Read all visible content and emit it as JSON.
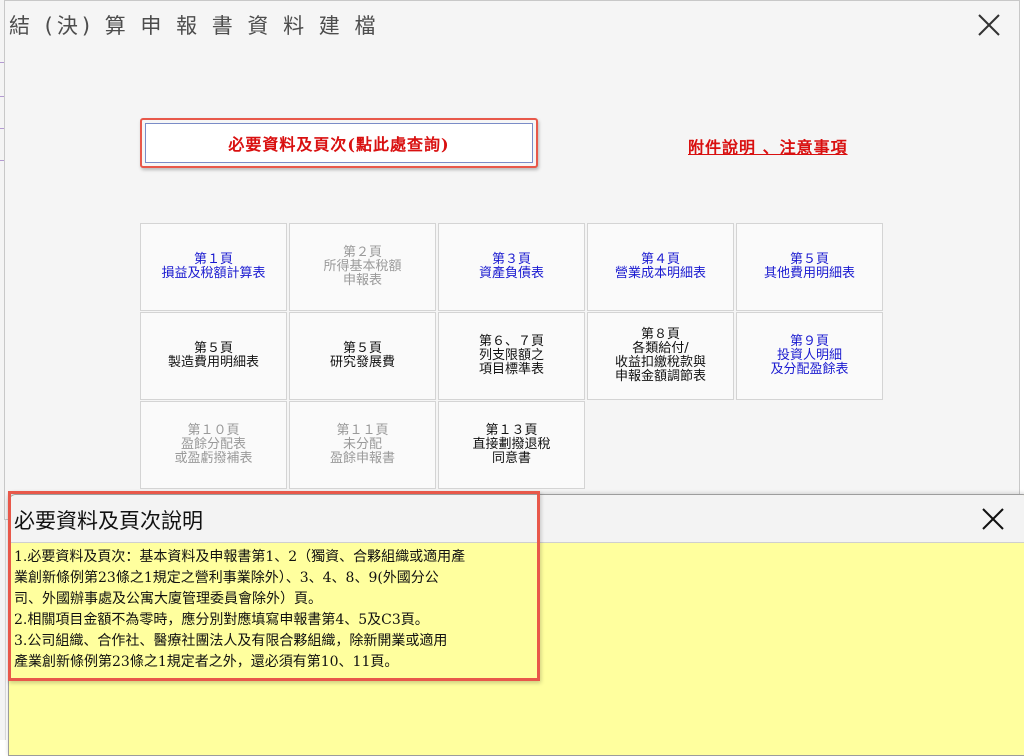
{
  "window": {
    "title": "結 (決) 算 申 報 書 資 料 建 檔"
  },
  "main": {
    "required_button_label": "必要資料及頁次(點此處查詢)",
    "notes_link_label": "附件說明 、注意事項",
    "pages": [
      {
        "label": "第１頁\n損益及稅額計算表",
        "state": "blue"
      },
      {
        "label": "第２頁\n所得基本稅額\n申報表",
        "state": "gray"
      },
      {
        "label": "第３頁\n資產負債表",
        "state": "blue"
      },
      {
        "label": "第４頁\n營業成本明細表",
        "state": "blue"
      },
      {
        "label": "第５頁\n其他費用明細表",
        "state": "blue"
      },
      {
        "label": "第５頁\n製造費用明細表",
        "state": "black"
      },
      {
        "label": "第５頁\n研究發展費",
        "state": "black"
      },
      {
        "label": "第６、７頁\n列支限額之\n項目標準表",
        "state": "black"
      },
      {
        "label": "第８頁\n各類給付/\n收益扣繳稅款與\n申報金額調節表",
        "state": "black"
      },
      {
        "label": "第９頁\n投資人明細\n及分配盈餘表",
        "state": "blue"
      },
      {
        "label": "第１０頁\n盈餘分配表\n或盈虧撥補表",
        "state": "gray"
      },
      {
        "label": "第１１頁\n未分配\n盈餘申報書",
        "state": "gray"
      },
      {
        "label": "第１３頁\n直接劃撥退稅\n同意書",
        "state": "black"
      }
    ]
  },
  "notes_dialog": {
    "title": "必要資料及頁次說明",
    "lines": [
      "1.必要資料及頁次：基本資料及申報書第1、2（獨資、合夥組織或適用產",
      "  業創新條例第23條之1規定之營利事業除外）、3、4、8、9(外國分公",
      "  司、外國辦事處及公寓大廈管理委員會除外）頁。",
      "2.相關項目金額不為零時，應分別對應填寫申報書第4、5及C3頁。",
      "3.公司組織、合作社、醫療社團法人及有限合夥組織，除新開業或適用",
      "  產業創新條例第23條之1規定者之外，還必須有第10、11頁。"
    ]
  },
  "colors": {
    "link_red": "#d91010",
    "page_blue": "#1a1ad0",
    "disabled_gray": "#9a9a9a",
    "highlight": "#e8584a",
    "notes_bg": "#ffff9e"
  },
  "icons": {
    "close": "close-icon"
  }
}
